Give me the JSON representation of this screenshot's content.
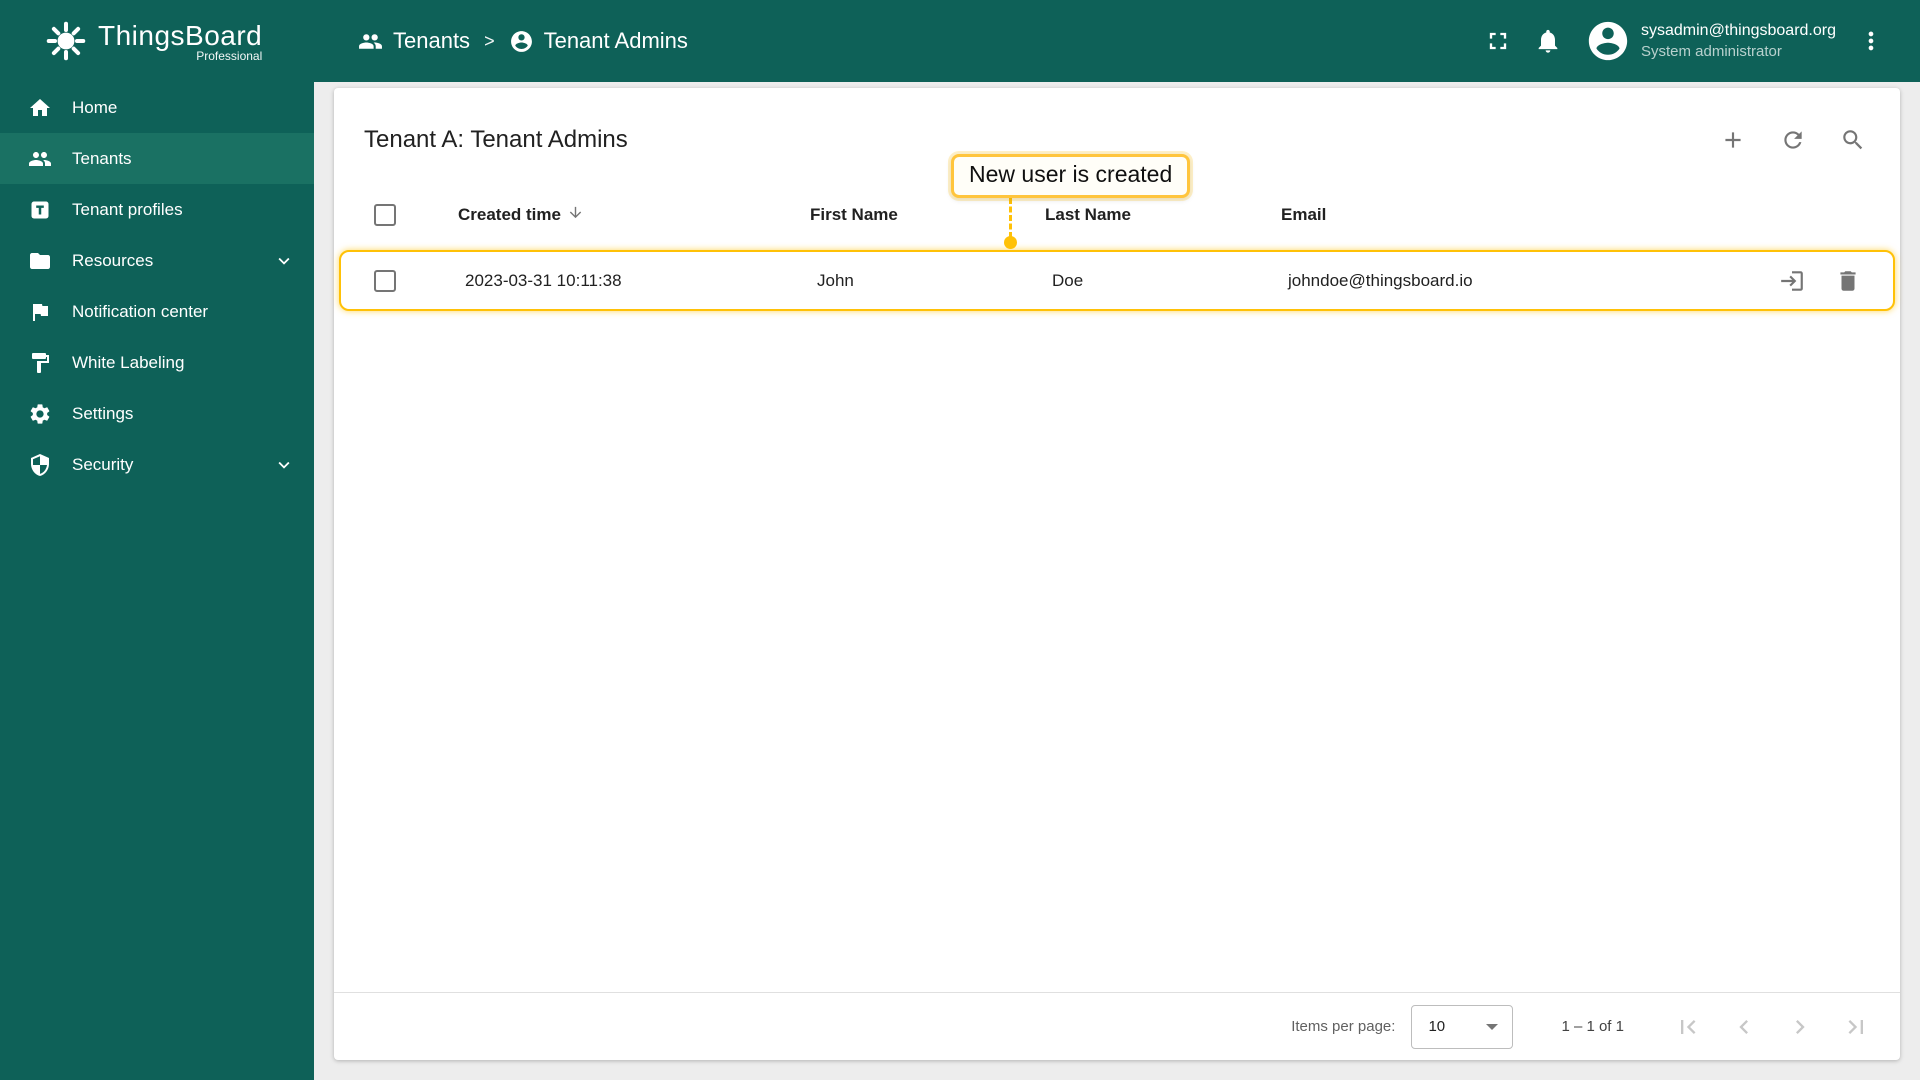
{
  "app": {
    "logo_title": "ThingsBoard",
    "logo_subtitle": "Professional"
  },
  "breadcrumb": {
    "separator": ">",
    "items": [
      {
        "label": "Tenants",
        "icon": "group-icon"
      },
      {
        "label": "Tenant Admins",
        "icon": "account-circle-icon"
      }
    ]
  },
  "topbar": {
    "user_email": "sysadmin@thingsboard.org",
    "user_role": "System administrator",
    "icons": [
      "fullscreen-icon",
      "notifications-icon",
      "avatar",
      "kebab-menu-icon"
    ]
  },
  "sidebar": {
    "items": [
      {
        "label": "Home",
        "icon": "home-icon",
        "active": false,
        "expandable": false
      },
      {
        "label": "Tenants",
        "icon": "group-icon",
        "active": true,
        "expandable": false
      },
      {
        "label": "Tenant profiles",
        "icon": "tenant-profile-icon",
        "active": false,
        "expandable": false
      },
      {
        "label": "Resources",
        "icon": "folder-icon",
        "active": false,
        "expandable": true
      },
      {
        "label": "Notification center",
        "icon": "flag-icon",
        "active": false,
        "expandable": false
      },
      {
        "label": "White Labeling",
        "icon": "paint-icon",
        "active": false,
        "expandable": false
      },
      {
        "label": "Settings",
        "icon": "gear-icon",
        "active": false,
        "expandable": false
      },
      {
        "label": "Security",
        "icon": "shield-icon",
        "active": false,
        "expandable": true
      }
    ]
  },
  "main": {
    "title": "Tenant A: Tenant Admins",
    "annotation": "New user is created",
    "toolbar_icons": [
      "add-icon",
      "refresh-icon",
      "search-icon"
    ],
    "table": {
      "columns": [
        "Created time",
        "First Name",
        "Last Name",
        "Email"
      ],
      "sorted_by": "Created time",
      "sort_direction": "desc",
      "rows": [
        {
          "created_time": "2023-03-31 10:11:38",
          "first_name": "John",
          "last_name": "Doe",
          "email": "johndoe@thingsboard.io",
          "row_icons": [
            "login-icon",
            "delete-icon"
          ]
        }
      ]
    },
    "paginator": {
      "items_per_page_label": "Items per page:",
      "items_per_page_value": "10",
      "range_label": "1 – 1 of 1"
    }
  },
  "colors": {
    "primary": "#0E6158",
    "primary_active": "#1A7163",
    "highlight": "#FFC107",
    "card_bg": "#FFFFFF",
    "page_bg": "#EDEDED"
  }
}
